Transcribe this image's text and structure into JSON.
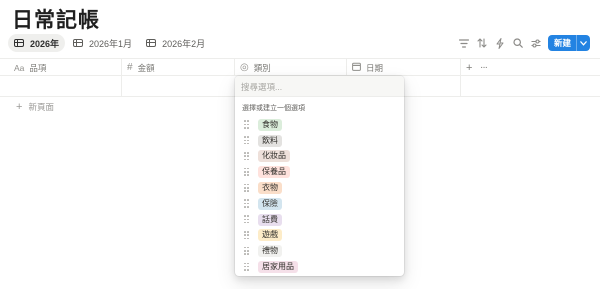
{
  "page": {
    "title": "日常記帳"
  },
  "views": [
    {
      "label": "2026年",
      "active": true
    },
    {
      "label": "2026年1月",
      "active": false
    },
    {
      "label": "2026年2月",
      "active": false
    }
  ],
  "toolbar": {
    "new_label": "新建"
  },
  "columns": [
    {
      "icon": "Aa",
      "label": "品項"
    },
    {
      "icon": "#",
      "label": "金額"
    },
    {
      "icon": "◎",
      "label": "類別"
    },
    {
      "icon": "calendar-icon",
      "label": "日期"
    }
  ],
  "new_page_label": "新頁面",
  "dropdown": {
    "search_placeholder": "搜尋選項...",
    "hint": "選擇或建立一個選項",
    "options": [
      {
        "label": "食物",
        "color": "#dbeddb"
      },
      {
        "label": "飲料",
        "color": "#e3e2e0"
      },
      {
        "label": "化妝品",
        "color": "#eee0da"
      },
      {
        "label": "保養品",
        "color": "#ffe2dd"
      },
      {
        "label": "衣物",
        "color": "#fadec9"
      },
      {
        "label": "保險",
        "color": "#d3e5ef"
      },
      {
        "label": "話費",
        "color": "#e8deee"
      },
      {
        "label": "遊戲",
        "color": "#fdecc8"
      },
      {
        "label": "禮物",
        "color": "#f1f1ef"
      },
      {
        "label": "居家用品",
        "color": "#f5e0e9"
      }
    ]
  }
}
